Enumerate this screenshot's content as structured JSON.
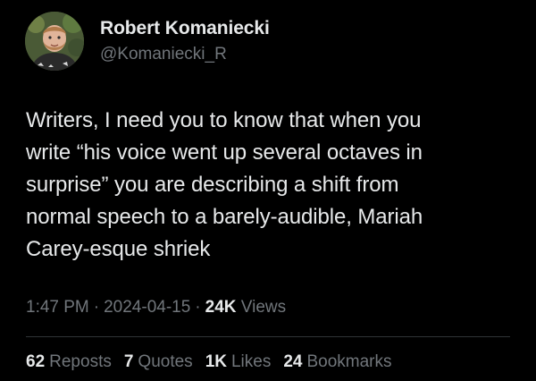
{
  "author": {
    "display_name": "Robert Komaniecki",
    "handle": "@Komaniecki_R",
    "avatar_icon": "profile-photo"
  },
  "tweet": {
    "text": "Writers, I need you to know that when you\nwrite “his voice went up several octaves in\nsurprise” you are describing a shift from\nnormal speech to a barely-audible, Mariah\nCarey-esque shriek"
  },
  "meta": {
    "time": "1:47 PM",
    "date": "2024-04-15",
    "views_count": "24K",
    "views_label": "Views",
    "separator": "·"
  },
  "stats": {
    "reposts": {
      "count": "62",
      "label": "Reposts"
    },
    "quotes": {
      "count": "7",
      "label": "Quotes"
    },
    "likes": {
      "count": "1K",
      "label": "Likes"
    },
    "bookmarks": {
      "count": "24",
      "label": "Bookmarks"
    }
  },
  "colors": {
    "background": "#000000",
    "primary_text": "#e7e9ea",
    "secondary_text": "#71767b",
    "divider": "#2f3336"
  }
}
